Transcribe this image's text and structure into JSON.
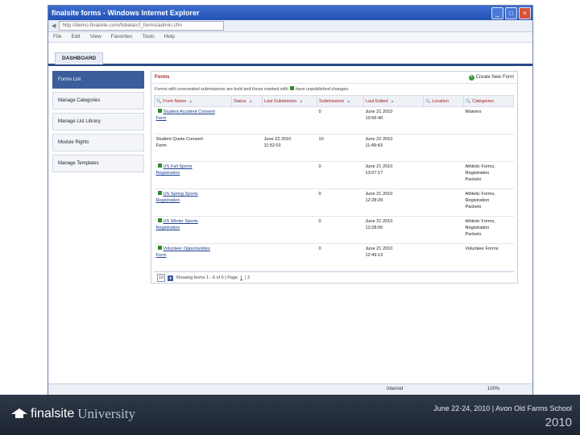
{
  "window": {
    "title": "finalsite forms - Windows Internet Explorer",
    "address": "http://demo.finalsite.com/fsbeta/cf_forms/admin.cfm"
  },
  "menu": [
    "File",
    "Edit",
    "View",
    "Favorites",
    "Tools",
    "Help"
  ],
  "tab": {
    "label": "DASHBOARD"
  },
  "sidebar": {
    "items": [
      {
        "label": "Forms List"
      },
      {
        "label": "Manage Categories"
      },
      {
        "label": "Manage List Library"
      },
      {
        "label": "Module Rights"
      },
      {
        "label": "Manage Templates"
      }
    ]
  },
  "panel": {
    "title": "Forms",
    "create_label": "Create New Form",
    "notice_start": "Forms with unrevealed submissions are bold and those marked with",
    "notice_end": "have unpublished changes."
  },
  "table": {
    "headers": [
      "Form Name",
      "Status",
      "Last Submission",
      "Submissions",
      "Last Edited",
      "Location",
      "Categories"
    ],
    "rows": [
      {
        "name_l1": "Student Accident Consent",
        "name_l2": "Form",
        "status": "",
        "last_sub_l1": "",
        "last_sub_l2": "",
        "subs": "0",
        "edited_l1": "June 21 2010",
        "edited_l2": "10:56:40",
        "location": "",
        "cat_l1": "Waivers",
        "cat_l2": "",
        "cat_l3": "",
        "marked": true,
        "linked": true
      },
      {
        "name_l1": "Student Quote Consent",
        "name_l2": "Form",
        "status": "",
        "last_sub_l1": "June 22 2010",
        "last_sub_l2": "11:52:01",
        "subs": "10",
        "edited_l1": "June 22 2010",
        "edited_l2": "11:49:43",
        "location": "",
        "cat_l1": "",
        "cat_l2": "",
        "cat_l3": "",
        "marked": false,
        "linked": false
      },
      {
        "name_l1": "US Fall Sports",
        "name_l2": "Registration",
        "status": "",
        "last_sub_l1": "",
        "last_sub_l2": "",
        "subs": "0",
        "edited_l1": "June 21 2010",
        "edited_l2": "13:07:17",
        "location": "",
        "cat_l1": "Athletic Forms,",
        "cat_l2": "Registration",
        "cat_l3": "Packets",
        "marked": true,
        "linked": true
      },
      {
        "name_l1": "US Spring Sports",
        "name_l2": "Registration",
        "status": "",
        "last_sub_l1": "",
        "last_sub_l2": "",
        "subs": "0",
        "edited_l1": "June 21 2010",
        "edited_l2": "12:28:29",
        "location": "",
        "cat_l1": "Athletic Forms,",
        "cat_l2": "Registration",
        "cat_l3": "Packets",
        "marked": true,
        "linked": true
      },
      {
        "name_l1": "US Winter Sports",
        "name_l2": "Registration",
        "status": "",
        "last_sub_l1": "",
        "last_sub_l2": "",
        "subs": "0",
        "edited_l1": "June 21 2010",
        "edited_l2": "12:28:00",
        "location": "",
        "cat_l1": "Athletic Forms,",
        "cat_l2": "Registration",
        "cat_l3": "Packets",
        "marked": true,
        "linked": true
      },
      {
        "name_l1": "Volunteer Opportunities",
        "name_l2": "Form",
        "status": "",
        "last_sub_l1": "",
        "last_sub_l2": "",
        "subs": "0",
        "edited_l1": "June 21 2010",
        "edited_l2": "12:49:13",
        "location": "",
        "cat_l1": "Volunteer Forms",
        "cat_l2": "",
        "cat_l3": "",
        "marked": true,
        "linked": true
      }
    ]
  },
  "pager": {
    "per_page": "10",
    "text": "Showing forms 1 - 6 of 6 | Page",
    "page": "1",
    "suffix": "| 2"
  },
  "statusbar": {
    "zone": "Internet",
    "zoom": "100%"
  },
  "footer": {
    "brand": "finalsite",
    "brand2": "University",
    "event": "June 22-24, 2010 | Avon Old Farms School",
    "year": "2010"
  }
}
